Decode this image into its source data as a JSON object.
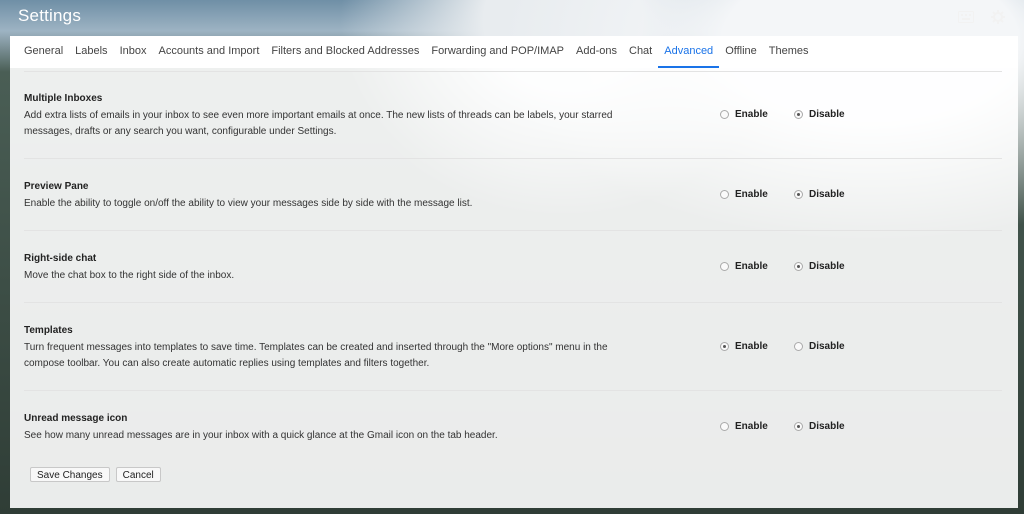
{
  "app": {
    "title": "Settings"
  },
  "top_icons": [
    "keyboard-icon",
    "gear-icon"
  ],
  "tabs": [
    {
      "label": "General",
      "active": false
    },
    {
      "label": "Labels",
      "active": false
    },
    {
      "label": "Inbox",
      "active": false
    },
    {
      "label": "Accounts and Import",
      "active": false
    },
    {
      "label": "Filters and Blocked Addresses",
      "active": false
    },
    {
      "label": "Forwarding and POP/IMAP",
      "active": false
    },
    {
      "label": "Add-ons",
      "active": false
    },
    {
      "label": "Chat",
      "active": false
    },
    {
      "label": "Advanced",
      "active": true
    },
    {
      "label": "Offline",
      "active": false
    },
    {
      "label": "Themes",
      "active": false
    }
  ],
  "settings": [
    {
      "name": "Multiple Inboxes",
      "description": "Add extra lists of emails in your inbox to see even more important emails at once. The new lists of threads can be labels, your starred messages, drafts or any search you want, configurable under Settings.",
      "enable_label": "Enable",
      "disable_label": "Disable",
      "selected": "disable"
    },
    {
      "name": "Preview Pane",
      "description": "Enable the ability to toggle on/off the ability to view your messages side by side with the message list.",
      "enable_label": "Enable",
      "disable_label": "Disable",
      "selected": "disable"
    },
    {
      "name": "Right-side chat",
      "description": "Move the chat box to the right side of the inbox.",
      "enable_label": "Enable",
      "disable_label": "Disable",
      "selected": "disable"
    },
    {
      "name": "Templates",
      "description": "Turn frequent messages into templates to save time. Templates can be created and inserted through the \"More options\" menu in the compose toolbar. You can also create automatic replies using templates and filters together.",
      "enable_label": "Enable",
      "disable_label": "Disable",
      "selected": "enable"
    },
    {
      "name": "Unread message icon",
      "description": "See how many unread messages are in your inbox with a quick glance at the Gmail icon on the tab header.",
      "enable_label": "Enable",
      "disable_label": "Disable",
      "selected": "disable"
    }
  ],
  "buttons": {
    "save_label": "Save Changes",
    "cancel_label": "Cancel"
  },
  "colors": {
    "accent": "#1a73e8"
  }
}
